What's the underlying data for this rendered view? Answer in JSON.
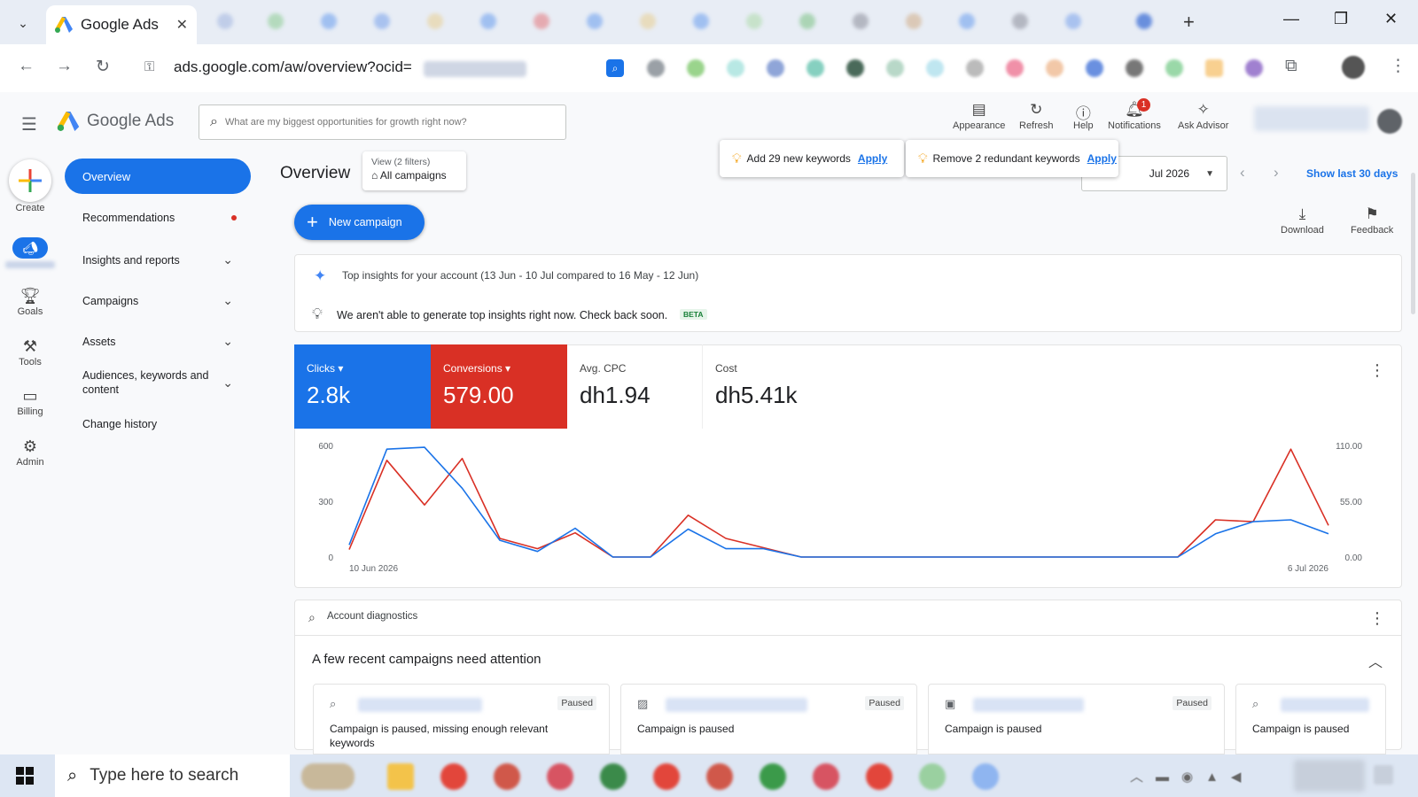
{
  "browser": {
    "tab_title": "Google Ads",
    "tab_close": "✕",
    "url": "ads.google.com/aw/overview?ocid=",
    "new_tab": "+",
    "minimize": "—",
    "restore": "❐",
    "close": "✕"
  },
  "header": {
    "brand": "Google Ads",
    "search_placeholder": "What are my biggest opportunities for growth right now?",
    "buttons": [
      {
        "label": "Appearance",
        "icon": "appearance-icon"
      },
      {
        "label": "Refresh",
        "icon": "refresh-icon"
      },
      {
        "label": "Help",
        "icon": "help-icon"
      },
      {
        "label": "Notifications",
        "icon": "bell-icon"
      },
      {
        "label": "Ask Advisor",
        "icon": "advisor-icon"
      }
    ],
    "notification_count": "1"
  },
  "rail": [
    {
      "label": "Create",
      "icon": "plus-icon"
    },
    {
      "label": "",
      "icon": "campaigns-icon"
    },
    {
      "label": "Goals",
      "icon": "trophy-icon"
    },
    {
      "label": "Tools",
      "icon": "tools-icon"
    },
    {
      "label": "Billing",
      "icon": "billing-icon"
    },
    {
      "label": "Admin",
      "icon": "gear-icon"
    }
  ],
  "nav": {
    "overview": "Overview",
    "recommendations": "Recommendations",
    "insights_reports": "Insights and reports",
    "campaigns": "Campaigns",
    "assets": "Assets",
    "audiences_line1": "Audiences, keywords and",
    "audiences_line2": "content",
    "change_history": "Change history"
  },
  "page": {
    "title": "Overview",
    "view_filters": "View (2 filters)",
    "view_value": "All campaigns",
    "date_range": "Jul 2026",
    "show_last": "Show last 30 days",
    "new_campaign": "New campaign",
    "download": "Download",
    "feedback": "Feedback"
  },
  "popups": {
    "add_keywords": "Add 29 new keywords",
    "remove_keywords": "Remove 2 redundant keywords",
    "apply": "Apply"
  },
  "insights": {
    "title": "Top insights for your account (13 Jun - 10 Jul compared to 16 May - 12 Jun)",
    "message": "We aren't able to generate top insights right now. Check back soon.",
    "beta": "BETA"
  },
  "metrics": {
    "clicks_label": "Clicks",
    "clicks_value": "2.8k",
    "conversions_label": "Conversions",
    "conversions_value": "579.00",
    "cpc_label": "Avg. CPC",
    "cpc_value": "dh1.94",
    "cost_label": "Cost",
    "cost_value": "dh5.41k"
  },
  "chart_data": {
    "type": "line",
    "x_start_label": "10 Jun 2026",
    "x_end_label": "6 Jul 2026",
    "y_left_ticks": [
      "0",
      "300",
      "600"
    ],
    "y_left_lim": [
      0,
      600
    ],
    "y_right_ticks": [
      "0.00",
      "55.00",
      "110.00"
    ],
    "y_right_lim": [
      0,
      110
    ],
    "grid": false,
    "colors": {
      "clicks": "#1a73e8",
      "conversions": "#d93025"
    },
    "series": [
      {
        "name": "Clicks",
        "axis": "left",
        "values": [
          65,
          580,
          590,
          370,
          90,
          30,
          155,
          0,
          0,
          150,
          45,
          45,
          0,
          0,
          0,
          0,
          0,
          0,
          0,
          0,
          0,
          0,
          0,
          125,
          190,
          200,
          125
        ]
      },
      {
        "name": "Conversions",
        "axis": "left",
        "values": [
          40,
          520,
          280,
          530,
          100,
          45,
          130,
          0,
          0,
          225,
          100,
          50,
          0,
          0,
          0,
          0,
          0,
          0,
          0,
          0,
          0,
          0,
          0,
          200,
          190,
          580,
          170
        ]
      }
    ]
  },
  "diagnostics": {
    "title": "Account diagnostics",
    "heading": "A few recent campaigns need attention",
    "cards": [
      {
        "status": "Paused",
        "message": "Campaign is paused, missing enough relevant keywords",
        "icon": "search-campaign-icon"
      },
      {
        "status": "Paused",
        "message": "Campaign is paused",
        "icon": "display-campaign-icon"
      },
      {
        "status": "Paused",
        "message": "Campaign is paused",
        "icon": "video-campaign-icon"
      },
      {
        "status": "",
        "message": "Campaign is paused",
        "icon": "search-campaign-icon"
      }
    ]
  },
  "taskbar": {
    "search_placeholder": "Type here to search"
  }
}
